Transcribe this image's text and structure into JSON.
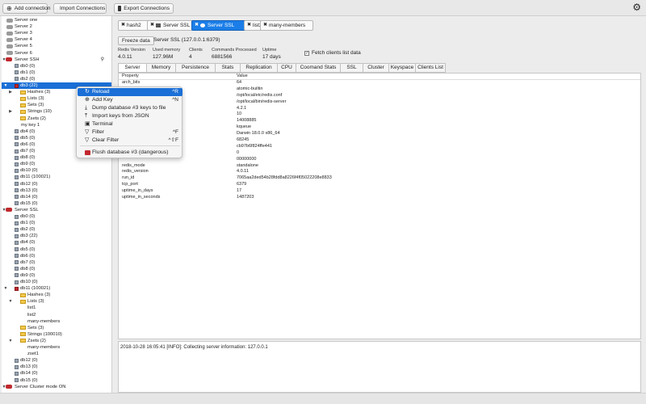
{
  "toolbar": {
    "add_connection": "Add connection",
    "import_connections": "Import Connections",
    "export_connections": "Export Connections"
  },
  "tree": [
    {
      "label": "Server one",
      "level": 0,
      "type": "server",
      "color": "gray",
      "toggle": ""
    },
    {
      "label": "Server 2",
      "level": 0,
      "type": "server",
      "color": "gray",
      "toggle": ""
    },
    {
      "label": "Server 3",
      "level": 0,
      "type": "server",
      "color": "gray",
      "toggle": ""
    },
    {
      "label": "Server 4",
      "level": 0,
      "type": "server",
      "color": "gray",
      "toggle": ""
    },
    {
      "label": "Server 5",
      "level": 0,
      "type": "server",
      "color": "gray",
      "toggle": ""
    },
    {
      "label": "Server 6",
      "level": 0,
      "type": "server",
      "color": "gray",
      "toggle": ""
    },
    {
      "label": "Server SSH",
      "level": 0,
      "type": "server",
      "color": "red",
      "toggle": "▼",
      "pin": "📌"
    },
    {
      "label": "db0 (0)",
      "level": 1,
      "type": "db"
    },
    {
      "label": "db1 (0)",
      "level": 1,
      "type": "db"
    },
    {
      "label": "db2 (0)",
      "level": 1,
      "type": "db"
    },
    {
      "label": "db3 (22)",
      "level": 1,
      "type": "db",
      "color": "red",
      "toggle": "▼",
      "selected": true
    },
    {
      "label": "Hashes (3)",
      "level": 2,
      "type": "folder",
      "toggle": "▶"
    },
    {
      "label": "Lists (3)",
      "level": 2,
      "type": "folder",
      "toggle": ""
    },
    {
      "label": "Sets (3)",
      "level": 2,
      "type": "folder",
      "toggle": ""
    },
    {
      "label": "Strings (10)",
      "level": 2,
      "type": "folder",
      "toggle": "▶"
    },
    {
      "label": "Zsets (2)",
      "level": 2,
      "type": "folder",
      "toggle": ""
    },
    {
      "label": "my key 1",
      "level": 2,
      "type": "key"
    },
    {
      "label": "db4 (0)",
      "level": 1,
      "type": "db"
    },
    {
      "label": "db5 (0)",
      "level": 1,
      "type": "db"
    },
    {
      "label": "db6 (0)",
      "level": 1,
      "type": "db"
    },
    {
      "label": "db7 (0)",
      "level": 1,
      "type": "db"
    },
    {
      "label": "db8 (0)",
      "level": 1,
      "type": "db"
    },
    {
      "label": "db9 (0)",
      "level": 1,
      "type": "db"
    },
    {
      "label": "db10 (0)",
      "level": 1,
      "type": "db"
    },
    {
      "label": "db11 (100021)",
      "level": 1,
      "type": "db"
    },
    {
      "label": "db12 (0)",
      "level": 1,
      "type": "db"
    },
    {
      "label": "db13 (0)",
      "level": 1,
      "type": "db"
    },
    {
      "label": "db14 (0)",
      "level": 1,
      "type": "db"
    },
    {
      "label": "db15 (0)",
      "level": 1,
      "type": "db"
    },
    {
      "label": "Server SSL",
      "level": 0,
      "type": "server",
      "color": "red",
      "toggle": "▼"
    },
    {
      "label": "db0 (0)",
      "level": 1,
      "type": "db"
    },
    {
      "label": "db1 (0)",
      "level": 1,
      "type": "db"
    },
    {
      "label": "db2 (0)",
      "level": 1,
      "type": "db"
    },
    {
      "label": "db3 (22)",
      "level": 1,
      "type": "db"
    },
    {
      "label": "db4 (0)",
      "level": 1,
      "type": "db"
    },
    {
      "label": "db5 (0)",
      "level": 1,
      "type": "db"
    },
    {
      "label": "db6 (0)",
      "level": 1,
      "type": "db"
    },
    {
      "label": "db7 (0)",
      "level": 1,
      "type": "db"
    },
    {
      "label": "db8 (0)",
      "level": 1,
      "type": "db"
    },
    {
      "label": "db9 (0)",
      "level": 1,
      "type": "db"
    },
    {
      "label": "db10 (0)",
      "level": 1,
      "type": "db"
    },
    {
      "label": "db11 (100021)",
      "level": 1,
      "type": "db",
      "color": "red",
      "toggle": "▼"
    },
    {
      "label": "Hashes (3)",
      "level": 2,
      "type": "folder",
      "toggle": ""
    },
    {
      "label": "Lists (3)",
      "level": 2,
      "type": "folder",
      "toggle": "▼"
    },
    {
      "label": "list1",
      "level": 3,
      "type": "key"
    },
    {
      "label": "list2",
      "level": 3,
      "type": "key"
    },
    {
      "label": "many-members",
      "level": 3,
      "type": "key"
    },
    {
      "label": "Sets (3)",
      "level": 2,
      "type": "folder",
      "toggle": ""
    },
    {
      "label": "Strings (100010)",
      "level": 2,
      "type": "folder",
      "toggle": ""
    },
    {
      "label": "Zsets (2)",
      "level": 2,
      "type": "folder",
      "toggle": "▼"
    },
    {
      "label": "many-members",
      "level": 3,
      "type": "key"
    },
    {
      "label": "zset1",
      "level": 3,
      "type": "key"
    },
    {
      "label": "db12 (0)",
      "level": 1,
      "type": "db"
    },
    {
      "label": "db13 (0)",
      "level": 1,
      "type": "db"
    },
    {
      "label": "db14 (0)",
      "level": 1,
      "type": "db"
    },
    {
      "label": "db15 (0)",
      "level": 1,
      "type": "db"
    },
    {
      "label": "Server Cluster mode ON",
      "level": 0,
      "type": "server",
      "color": "red",
      "toggle": "▼"
    }
  ],
  "open_tabs": [
    {
      "label": "hash2",
      "active": false
    },
    {
      "label": "Server SSL",
      "active": false
    },
    {
      "label": "Server SSL",
      "active": true
    },
    {
      "label": "list2",
      "active": false
    },
    {
      "label": "many-members",
      "active": false
    }
  ],
  "server_info": {
    "freeze_label": "Freeze data",
    "title": "Server SSL (127.0.0.1:6379)",
    "stats": [
      {
        "label": "Redis Version",
        "value": "4.0.11"
      },
      {
        "label": "Used memory",
        "value": "127.96M"
      },
      {
        "label": "Clients",
        "value": "4"
      },
      {
        "label": "Commands Processed",
        "value": "6881566"
      },
      {
        "label": "Uptime",
        "value": "17 days"
      }
    ],
    "fetch_clients_label": "Fetch clients list data",
    "fetch_clients_checked": true
  },
  "info_tabs": [
    "Server",
    "Memory",
    "Persistence",
    "Stats",
    "Replication",
    "CPU",
    "Coomand Stats",
    "SSL",
    "Cluster",
    "Keyspace",
    "Clients List"
  ],
  "table": {
    "headers": [
      "Property",
      "Value"
    ],
    "rows": [
      {
        "p": "arch_bits",
        "v": "64"
      },
      {
        "p": "",
        "v": "atomic-builtin"
      },
      {
        "p": "",
        "v": "/opt/local/etc/redis.conf"
      },
      {
        "p": "",
        "v": "/opt/local/bin/redis-server"
      },
      {
        "p": "",
        "v": "4.2.1"
      },
      {
        "p": "",
        "v": "10"
      },
      {
        "p": "",
        "v": "14008885"
      },
      {
        "p": "",
        "v": "kqueue"
      },
      {
        "p": "",
        "v": "Darwin 18.0.0 x86_64"
      },
      {
        "p": "",
        "v": "68245"
      },
      {
        "p": "",
        "v": "cb97b6f824ffe441"
      },
      {
        "p": "",
        "v": "0"
      },
      {
        "p": "",
        "v": "00000000"
      },
      {
        "p": "redis_mode",
        "v": "standalone"
      },
      {
        "p": "redis_version",
        "v": "4.0.11"
      },
      {
        "p": "run_id",
        "v": "7065aa2ded54b28fdd8a8226f4f05022208e8833"
      },
      {
        "p": "tcp_port",
        "v": "6379"
      },
      {
        "p": "uptime_in_days",
        "v": "17"
      },
      {
        "p": "uptime_in_seconds",
        "v": "1487203"
      }
    ]
  },
  "log": {
    "line": "2018-10-28 16:05:41 [INFO]: Collecting server information: 127.0.0.1"
  },
  "context_menu": [
    {
      "label": "Reload",
      "key": "^R",
      "icon": "reload-icon",
      "highlight": true
    },
    {
      "label": "Add Key",
      "key": "^N",
      "icon": "add-icon"
    },
    {
      "label": "Dump database #3 keys to file",
      "key": "",
      "icon": "dump-icon"
    },
    {
      "label": "Import keys from JSON",
      "key": "",
      "icon": "import-icon"
    },
    {
      "label": "Terminal",
      "key": "",
      "icon": "terminal-icon"
    },
    {
      "label": "Filter",
      "key": "^F",
      "icon": "filter-icon"
    },
    {
      "label": "Clear Filter",
      "key": "^⇧F",
      "icon": "clear-filter-icon"
    },
    {
      "label": "Flush database #3 (dangerous)",
      "key": "",
      "icon": "flush-icon",
      "danger": true
    }
  ],
  "colors": {
    "accent": "#1b6fd6",
    "danger": "#c0282d"
  }
}
